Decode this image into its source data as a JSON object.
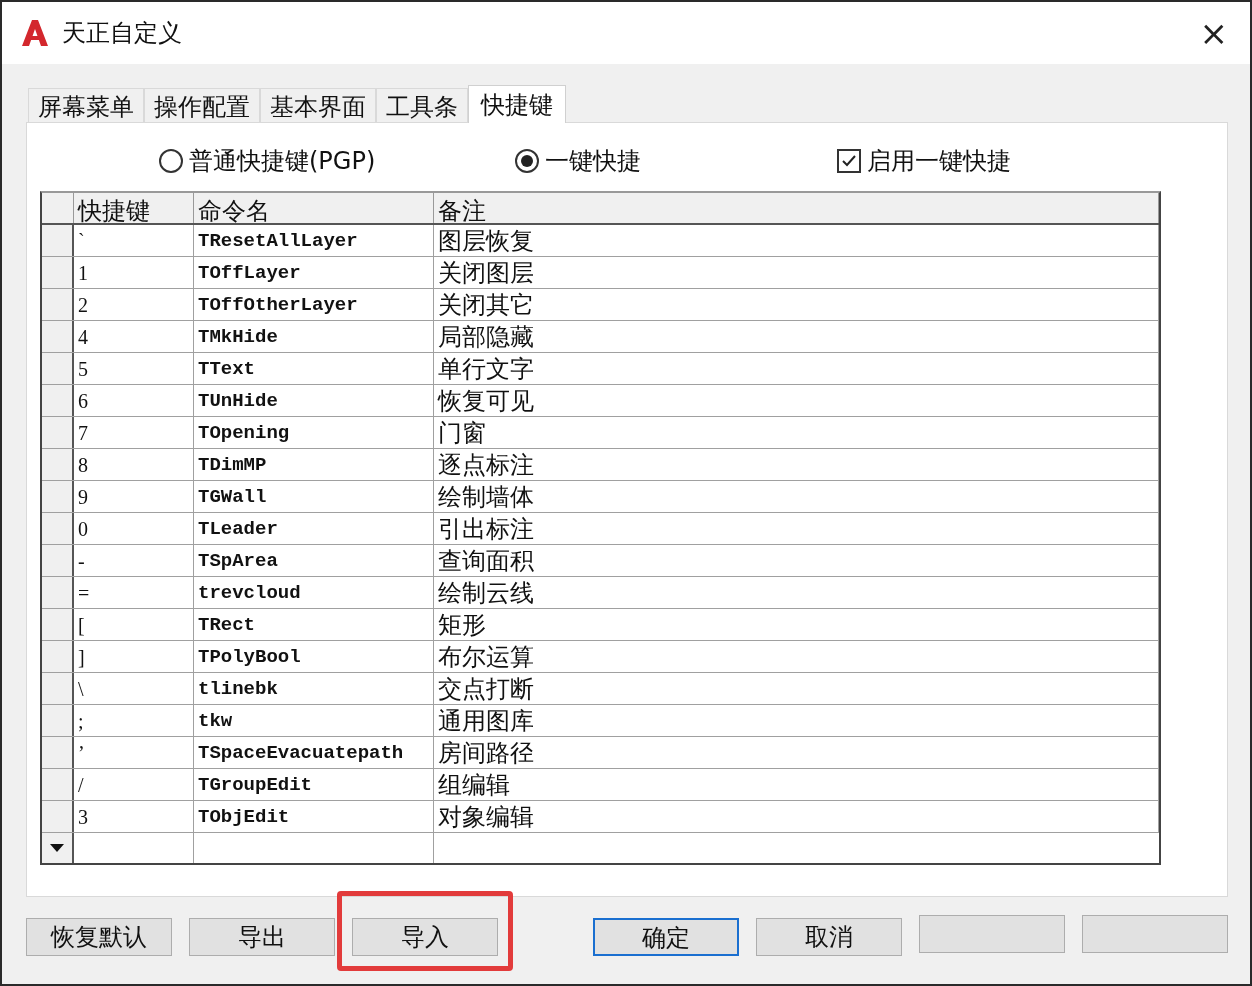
{
  "window": {
    "title": "天正自定义",
    "close": "×"
  },
  "tabs": [
    {
      "label": "屏幕菜单",
      "selected": false
    },
    {
      "label": "操作配置",
      "selected": false
    },
    {
      "label": "基本界面",
      "selected": false
    },
    {
      "label": "工具条",
      "selected": false
    },
    {
      "label": "快捷键",
      "selected": true
    }
  ],
  "options": [
    {
      "kind": "radio",
      "label": "普通快捷键(PGP)",
      "selected": false
    },
    {
      "kind": "radio",
      "label": "一键快捷",
      "selected": true
    },
    {
      "kind": "checkbox",
      "label": "启用一键快捷",
      "checked": true
    }
  ],
  "table": {
    "columns": [
      "快捷键",
      "命令名",
      "备注"
    ],
    "rows": [
      [
        "`",
        "TResetAllLayer",
        "图层恢复"
      ],
      [
        "1",
        "TOffLayer",
        "关闭图层"
      ],
      [
        "2",
        "TOffOtherLayer",
        "关闭其它"
      ],
      [
        "4",
        "TMkHide",
        "局部隐藏"
      ],
      [
        "5",
        "TText",
        "单行文字"
      ],
      [
        "6",
        "TUnHide",
        "恢复可见"
      ],
      [
        "7",
        "TOpening",
        "门窗"
      ],
      [
        "8",
        "TDimMP",
        "逐点标注"
      ],
      [
        "9",
        "TGWall",
        "绘制墙体"
      ],
      [
        "0",
        "TLeader",
        "引出标注"
      ],
      [
        "-",
        "TSpArea",
        "查询面积"
      ],
      [
        "=",
        "trevcloud",
        "绘制云线"
      ],
      [
        "[",
        "TRect",
        "矩形"
      ],
      [
        "]",
        "TPolyBool",
        "布尔运算"
      ],
      [
        "\\",
        "tlinebk",
        "交点打断"
      ],
      [
        ";",
        "tkw",
        "通用图库"
      ],
      [
        "’",
        "TSpaceEvacuatepath",
        "房间路径"
      ],
      [
        "/",
        "TGroupEdit",
        "组编辑"
      ],
      [
        "3",
        "TObjEdit",
        "对象编辑"
      ]
    ]
  },
  "buttons": [
    {
      "label": "恢复默认",
      "default": false,
      "highlighted": false
    },
    {
      "label": "导出",
      "default": false,
      "highlighted": false
    },
    {
      "label": "导入",
      "default": false,
      "highlighted": true
    },
    {
      "label": "确定",
      "default": true,
      "highlighted": false
    },
    {
      "label": "取消",
      "default": false,
      "highlighted": false
    },
    {
      "default": false,
      "highlighted": false
    },
    {
      "default": false,
      "highlighted": false
    }
  ]
}
